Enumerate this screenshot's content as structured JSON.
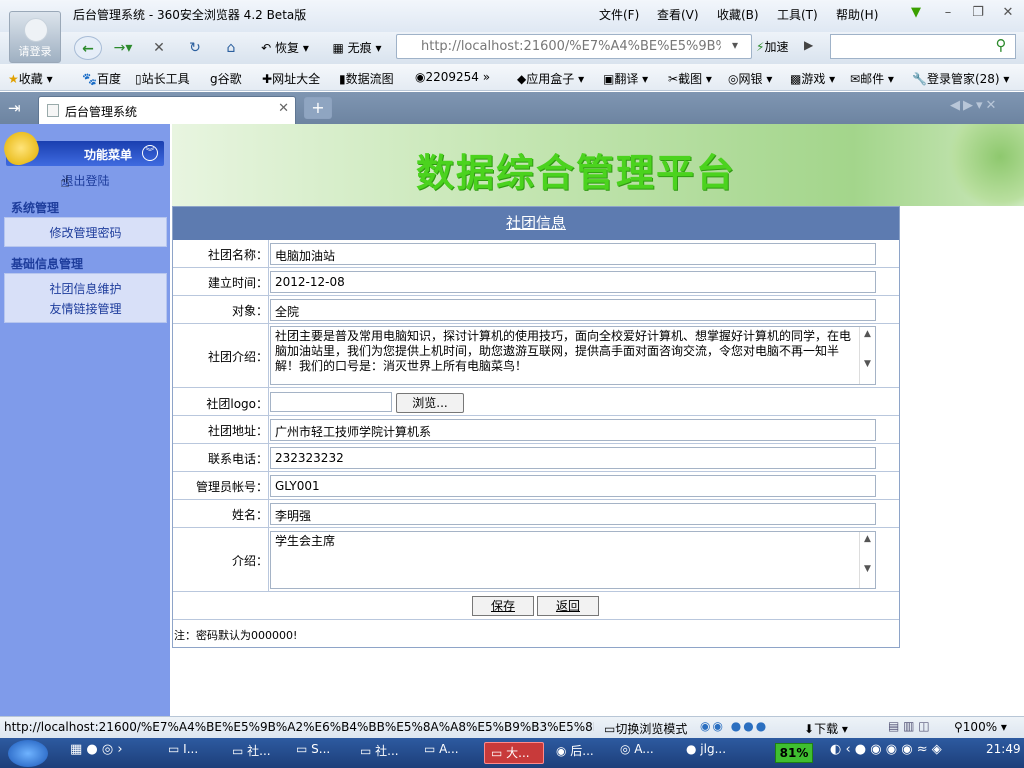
{
  "window": {
    "title": "后台管理系统 - 360安全浏览器 4.2 Beta版",
    "login_label": "请登录",
    "menu": [
      "文件(F)",
      "查看(V)",
      "收藏(B)",
      "工具(T)",
      "帮助(H)"
    ]
  },
  "navbar": {
    "restore": "恢复",
    "no_trace": "无痕",
    "address": "http://localhost:21600/%E7%A4%BE%E5%9B%",
    "speedup": "加速"
  },
  "favorites": [
    "收藏",
    "百度",
    "站长工具",
    "谷歌",
    "网址大全",
    "数据流图",
    "2209254",
    "应用盒子",
    "翻译",
    "截图",
    "网银",
    "游戏",
    "邮件",
    "登录管家(28)"
  ],
  "tab": {
    "label": "后台管理系统"
  },
  "sidebar": {
    "header": "功能菜单",
    "logout": "退出登陆",
    "sections": [
      {
        "title": "系统管理",
        "items": [
          "修改管理密码"
        ]
      },
      {
        "title": "基础信息管理",
        "items": [
          "社团信息维护",
          "友情链接管理"
        ]
      }
    ]
  },
  "banner": {
    "title": "数据综合管理平台"
  },
  "form": {
    "title": "社团信息",
    "fields": [
      {
        "label": "社团名称：",
        "value": "电脑加油站"
      },
      {
        "label": "建立时间：",
        "value": "2012-12-08"
      },
      {
        "label": "对象：",
        "value": "全院"
      },
      {
        "label": "社团介绍：",
        "value": "社团主要是普及常用电脑知识，探讨计算机的使用技巧，面向全校爱好计算机、想掌握好计算机的同学，在电脑加油站里，我们为您提供上机时间，助您遨游互联网，提供高手面对面咨询交流，令您对电脑不再一知半解！我们的口号是：消灭世界上所有电脑菜鸟！"
      },
      {
        "label": "社团logo：",
        "value": "",
        "browse": "浏览..."
      },
      {
        "label": "社团地址：",
        "value": "广州市轻工技师学院计算机系"
      },
      {
        "label": "联系电话：",
        "value": "232323232"
      },
      {
        "label": "管理员帐号：",
        "value": "GLY001"
      },
      {
        "label": "姓名：",
        "value": "李明强"
      },
      {
        "label": "介绍：",
        "value": "学生会主席"
      }
    ],
    "save": "保存",
    "back": "返回",
    "note": "注：密码默认为000000!"
  },
  "statusbar": {
    "url": "http://localhost:21600/%E7%A4%BE%E5%9B%A2%E6%B4%BB%E5%8A%A8%E5%B9%B3%E5%8F...",
    "mode": "切换浏览模式",
    "download": "下载",
    "zoom": "100%"
  },
  "taskbar": {
    "items": [
      "I...",
      "社...",
      "S...",
      "社...",
      "A...",
      "大...",
      "后...",
      "A...",
      "jlg..."
    ],
    "battery": "81%",
    "time": "21:49"
  }
}
